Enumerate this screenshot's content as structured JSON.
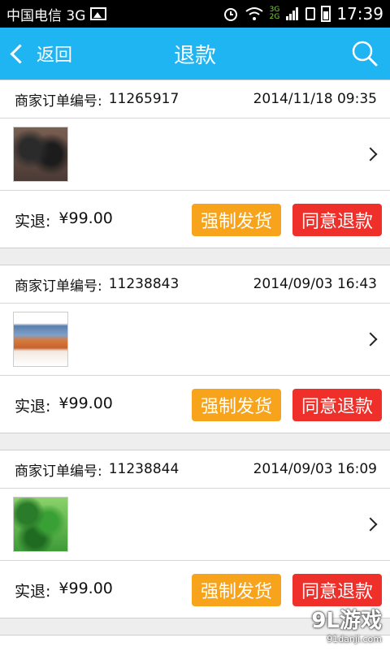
{
  "status_bar": {
    "carrier": "中国电信 3G",
    "net_top": "3G",
    "net_bottom": "2G",
    "time": "17:39",
    "icons": [
      "image-icon",
      "alarm-icon",
      "wifi-icon",
      "signal-icon",
      "sim-icon",
      "battery-icon"
    ]
  },
  "header": {
    "back_label": "返回",
    "title": "退款",
    "accent_color": "#1fb4f2"
  },
  "orders": [
    {
      "order_label": "商家订单编号:",
      "order_no": "11265917",
      "datetime": "2014/11/18 09:35",
      "refund_label": "实退:",
      "amount": "¥99.00",
      "force_ship_label": "强制发货",
      "agree_refund_label": "同意退款"
    },
    {
      "order_label": "商家订单编号:",
      "order_no": "11238843",
      "datetime": "2014/09/03 16:43",
      "refund_label": "实退:",
      "amount": "¥99.00",
      "force_ship_label": "强制发货",
      "agree_refund_label": "同意退款"
    },
    {
      "order_label": "商家订单编号:",
      "order_no": "11238844",
      "datetime": "2014/09/03 16:09",
      "refund_label": "实退:",
      "amount": "¥99.00",
      "force_ship_label": "强制发货",
      "agree_refund_label": "同意退款"
    }
  ],
  "colors": {
    "force_ship": "#f7a31c",
    "agree_refund": "#ef2f2a"
  },
  "watermark": {
    "brand": "9L游戏",
    "site": "91danji.com"
  }
}
